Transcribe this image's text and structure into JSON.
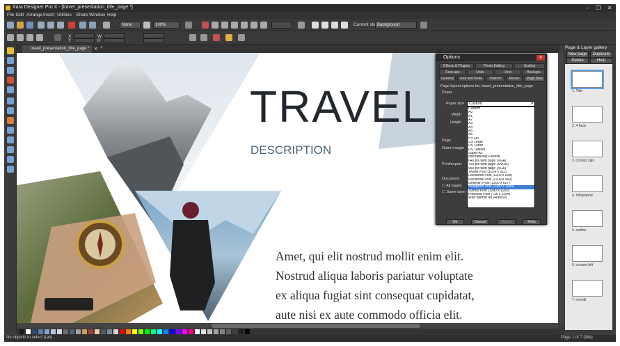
{
  "window": {
    "title": "Xara Designer Pro X - [travel_presentation_title_page *]",
    "controls": [
      "–",
      "❐",
      "✕"
    ]
  },
  "menu": [
    "File",
    "Edit",
    "Arrange",
    "Insert",
    "Utilities",
    "Share",
    "Window",
    "Help"
  ],
  "toolbar": {
    "fill_mode": "None",
    "zoom": "100%",
    "current_step_label": "Current step:",
    "current_step_value": "Background"
  },
  "infobar": {
    "x_label": "X",
    "y_label": "Y",
    "w_label": "W",
    "h_label": "H"
  },
  "doc_tab": "travel_presentation_title_page *",
  "canvas": {
    "title": "TRAVEL",
    "description": "DESCRIPTION",
    "body_lines": [
      "Amet, qui elit nostrud mollit enim elit.",
      "Nostrud aliqua laboris pariatur voluptate",
      "ex aliqua fugiat sint consequat cupidatat,",
      "aute nisi ex aute commodo officia elit."
    ]
  },
  "options_dialog": {
    "title": "Options",
    "tabs_row1": [
      "Effects & Plugins",
      "Photo Editing",
      "Scaling"
    ],
    "tabs_row2": [
      "Tune-ups",
      "Units",
      "View",
      "Backups"
    ],
    "tabs_row3": [
      "General",
      "Grid and Ruler",
      "Internet",
      "Mouse",
      "Page Size"
    ],
    "heading": "Page layout options for: travel_presentation_title_page",
    "paper_group": "Paper",
    "paper_size_label": "Paper size",
    "paper_size_value": "Custom",
    "width_label": "Width",
    "height_label": "Height",
    "page_group": "Page",
    "outer_margin_label": "Outer margin",
    "print_label": "Print/export",
    "document_group": "Document",
    "all_pages_label": "All pages",
    "same_layer_label": "Same layer",
    "paper_options": [
      "Custom",
      "A0",
      "A1",
      "A2",
      "A3",
      "A4",
      "A5",
      "A6",
      "6 x 6in",
      "US Legal",
      "US Letter",
      "US Tabloid",
      "Super A3",
      "International Fanfold",
      "640 pix web page (VGA)",
      "760 pix web page (SVGA)",
      "960 pix web page (XGA)",
      "Twitter Post (1024 x 512)",
      "Facebook Post (1200 x 628)",
      "Facebook Post (1200 x 900)",
      "LinkedIn Post (1200 x 627)",
      "Instagram Post (1080 x 1080)",
      "Tumblr Post (1280 x 1920)",
      "Pinterest Post (736 x 1104)",
      "Web banner ad (468x60)"
    ],
    "highlighted_option": "Instagram Post (1080 x 1080)",
    "buttons": [
      "Ok",
      "Cancel",
      "Apply",
      "Help"
    ]
  },
  "gallery": {
    "title": "Page & Layer gallery",
    "buttons": [
      "New page",
      "Duplicate",
      "Delete",
      "Help"
    ],
    "pages": [
      {
        "label": "1. Title"
      },
      {
        "label": "2. 4 facts"
      },
      {
        "label": "3. contact sign"
      },
      {
        "label": "4. Infographic"
      },
      {
        "label": "5. outline"
      },
      {
        "label": "6. content left"
      },
      {
        "label": "7. overall"
      }
    ]
  },
  "status": {
    "left": "No objects to select (tab)",
    "right": "Page 1 of 7 (title)"
  },
  "swatches": [
    "#1a1a1a",
    "#ffffff",
    "#2a4a70",
    "#5a7fa8",
    "#8aa4c4",
    "#b9c8dc",
    "#d8d8d8",
    "#6b6b6b",
    "#4a6478",
    "#a0a0a0",
    "#c8a060",
    "#a04030",
    "#e8d0b0",
    "#505a60",
    "#7a8a96",
    "#cfd6dc",
    "#ff0000",
    "#ff8000",
    "#ffff00",
    "#80ff00",
    "#00ff00",
    "#00ff80",
    "#00ffff",
    "#0080ff",
    "#0000ff",
    "#8000ff",
    "#ff00ff",
    "#ff0080",
    "#ffffff",
    "#e0e0e0",
    "#c0c0c0",
    "#a0a0a0",
    "#808080",
    "#606060",
    "#404040",
    "#202020",
    "#000000"
  ]
}
